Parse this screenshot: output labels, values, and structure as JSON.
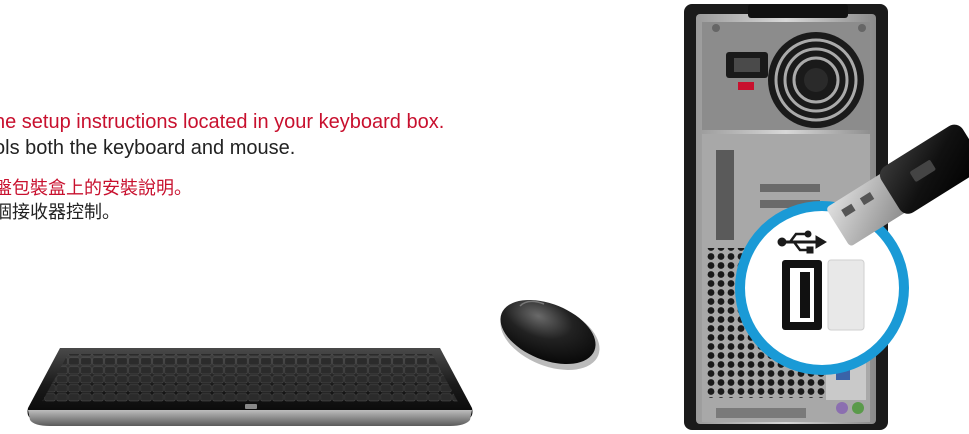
{
  "instructions": {
    "english": {
      "line1": "he setup instructions located in your keyboard box.",
      "line2": "ols both the keyboard and mouse."
    },
    "chinese": {
      "line1": "盤包裝盒上的安裝說明。",
      "line2": "個接收器控制。"
    }
  },
  "colors": {
    "accent_red": "#c8102e",
    "text_dark": "#222222",
    "highlight_blue": "#1a9ad6",
    "device_black": "#1c1c1c"
  },
  "icons": [
    "keyboard-image",
    "mouse-image",
    "pc-tower-image",
    "usb-symbol-icon",
    "usb-receiver-dongle"
  ]
}
